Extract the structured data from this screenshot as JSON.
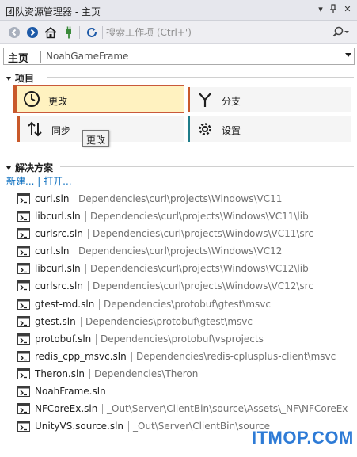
{
  "window": {
    "title": "团队资源管理器 - 主页",
    "pin_glyph": "▾",
    "close_glyph": "✕",
    "pushpin_glyph": "⊥"
  },
  "toolbar": {
    "search_placeholder": "搜索工作项 (Ctrl+')"
  },
  "repo_bar": {
    "page": "主页",
    "repo_name": "NoahGameFrame"
  },
  "project_section": {
    "title": "项目",
    "tiles": [
      {
        "label": "更改",
        "icon": "clock-icon",
        "accent": "#c9592a",
        "active": true
      },
      {
        "label": "分支",
        "icon": "branch-icon",
        "accent": "#c9592a",
        "active": false
      },
      {
        "label": "同步",
        "icon": "sync-arrows-icon",
        "accent": "#c9592a",
        "active": false
      },
      {
        "label": "设置",
        "icon": "gear-icon",
        "accent": "#1f7d8a",
        "active": false
      }
    ],
    "tooltip": "更改"
  },
  "solution_section": {
    "title": "解决方案",
    "new_link": "新建...",
    "open_link": "打开...",
    "solutions": [
      {
        "name": "curl.sln",
        "path": "Dependencies\\curl\\projects\\Windows\\VC11"
      },
      {
        "name": "libcurl.sln",
        "path": "Dependencies\\curl\\projects\\Windows\\VC11\\lib"
      },
      {
        "name": "curlsrc.sln",
        "path": "Dependencies\\curl\\projects\\Windows\\VC11\\src"
      },
      {
        "name": "curl.sln",
        "path": "Dependencies\\curl\\projects\\Windows\\VC12"
      },
      {
        "name": "libcurl.sln",
        "path": "Dependencies\\curl\\projects\\Windows\\VC12\\lib"
      },
      {
        "name": "curlsrc.sln",
        "path": "Dependencies\\curl\\projects\\Windows\\VC12\\src"
      },
      {
        "name": "gtest-md.sln",
        "path": "Dependencies\\protobuf\\gtest\\msvc"
      },
      {
        "name": "gtest.sln",
        "path": "Dependencies\\protobuf\\gtest\\msvc"
      },
      {
        "name": "protobuf.sln",
        "path": "Dependencies\\protobuf\\vsprojects"
      },
      {
        "name": "redis_cpp_msvc.sln",
        "path": "Dependencies\\redis-cplusplus-client\\msvc"
      },
      {
        "name": "Theron.sln",
        "path": "Dependencies\\Theron"
      },
      {
        "name": "NoahFrame.sln",
        "path": ""
      },
      {
        "name": "NFCoreEx.sln",
        "path": "_Out\\Server\\ClientBin\\source\\Assets\\_NF\\NFCoreEx"
      },
      {
        "name": "UnityVS.source.sln",
        "path": "_Out\\Server\\ClientBin\\source"
      }
    ]
  },
  "watermark": "ITMOP.COM",
  "colors": {
    "accent_orange": "#c9592a",
    "accent_teal": "#1f7d8a",
    "active_tile": "#fff2c0",
    "link": "#0e70c0",
    "toolbar_blue": "#1e5aa8"
  }
}
